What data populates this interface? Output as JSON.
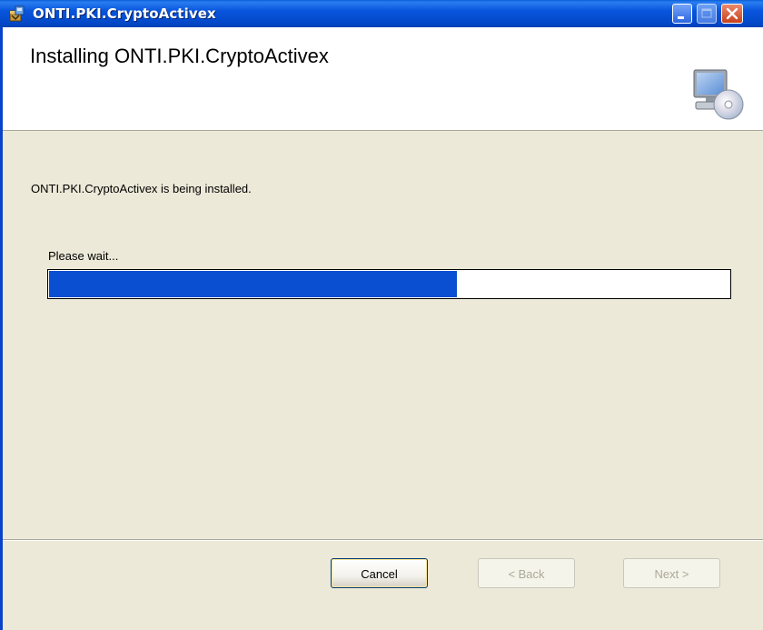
{
  "window": {
    "title": "ONTI.PKI.CryptoActivex",
    "icon": "installer-package-icon",
    "controls": {
      "minimize": "minimize-icon",
      "maximize": "maximize-icon",
      "close": "close-icon"
    }
  },
  "banner": {
    "title": "Installing ONTI.PKI.CryptoActivex",
    "icon": "computer-cd-icon"
  },
  "body": {
    "status_text": "ONTI.PKI.CryptoActivex is being installed.",
    "wait_text": "Please wait..."
  },
  "progress": {
    "value": 0.6
  },
  "buttons": {
    "cancel": "Cancel",
    "back": "< Back",
    "next": "Next >"
  },
  "colors": {
    "titlebar": "#0855dd",
    "progress_fill": "#0a4fd1",
    "background": "#ece9d8"
  }
}
